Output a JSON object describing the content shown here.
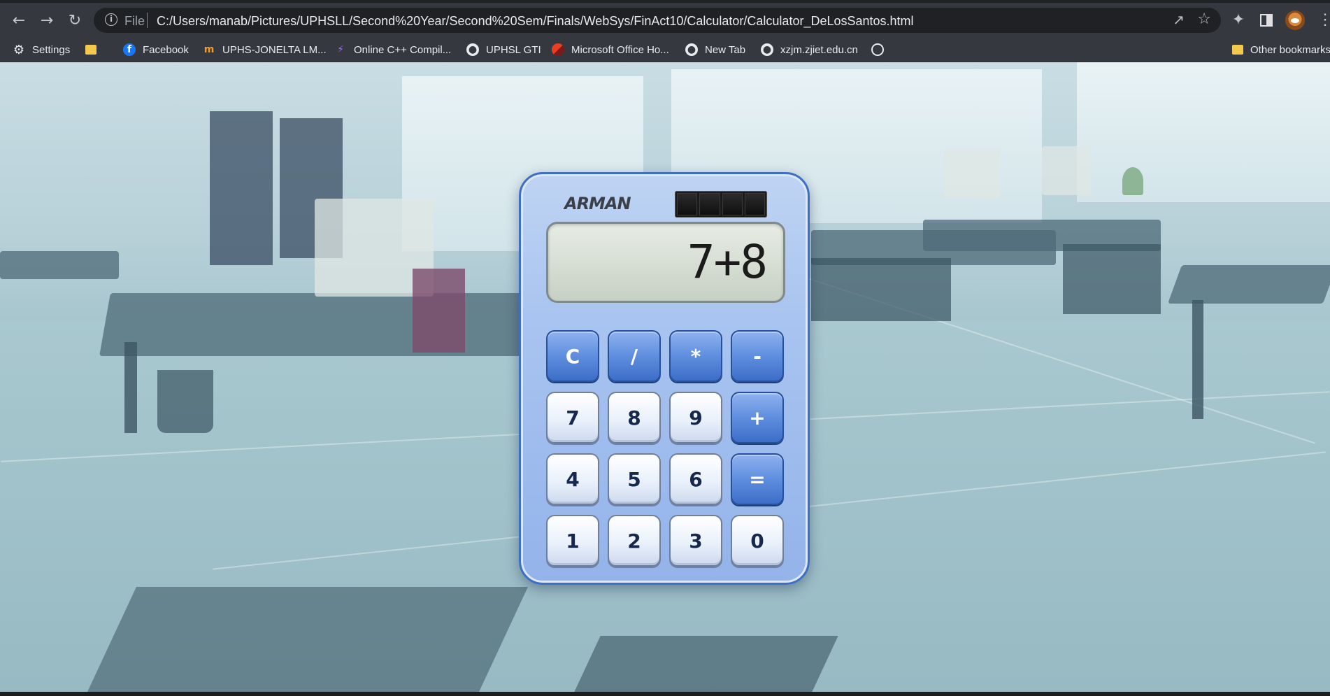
{
  "browser": {
    "omnibox": {
      "scheme_label": "File",
      "url": "C:/Users/manab/Pictures/UPHSLL/Second%20Year/Second%20Sem/Finals/WebSys/FinAct10/Calculator/Calculator_DeLosSantos.html"
    },
    "icons": {
      "back": "back-arrow-icon",
      "forward": "forward-arrow-icon",
      "reload": "reload-icon",
      "share": "share-icon",
      "bookmark": "star-icon",
      "extensions": "puzzle-icon",
      "side_panel": "side-panel-icon",
      "menu": "kebab-menu-icon"
    },
    "bookmarks": [
      {
        "label": "Settings",
        "icon": "gear-icon"
      },
      {
        "label": "",
        "icon": "folder-icon"
      },
      {
        "label": "Facebook",
        "icon": "facebook-icon"
      },
      {
        "label": "UPHS-JONELTA LM...",
        "icon": "moodle-icon"
      },
      {
        "label": "Online C++ Compil...",
        "icon": "bolt-icon"
      },
      {
        "label": "UPHSL GTI",
        "icon": "globe-icon"
      },
      {
        "label": "Microsoft Office Ho...",
        "icon": "office-icon"
      },
      {
        "label": "New Tab",
        "icon": "globe-icon"
      },
      {
        "label": "xzjm.zjiet.edu.cn",
        "icon": "globe-icon"
      },
      {
        "label": "",
        "icon": "app-icon"
      }
    ],
    "other_bookmarks": "Other bookmarks"
  },
  "calculator": {
    "brand": "ARMAN",
    "display": "7+8",
    "keys": [
      {
        "label": "C",
        "style": "dark"
      },
      {
        "label": "/",
        "style": "dark"
      },
      {
        "label": "*",
        "style": "dark"
      },
      {
        "label": "-",
        "style": "dark"
      },
      {
        "label": "7",
        "style": "light"
      },
      {
        "label": "8",
        "style": "light"
      },
      {
        "label": "9",
        "style": "light"
      },
      {
        "label": "+",
        "style": "dark"
      },
      {
        "label": "4",
        "style": "light"
      },
      {
        "label": "5",
        "style": "light"
      },
      {
        "label": "6",
        "style": "light"
      },
      {
        "label": "=",
        "style": "dark"
      },
      {
        "label": "1",
        "style": "light"
      },
      {
        "label": "2",
        "style": "light"
      },
      {
        "label": "3",
        "style": "light"
      },
      {
        "label": "0",
        "style": "light"
      }
    ],
    "colors": {
      "body": "#a9c4f0",
      "border": "#3e6fc4",
      "dark_key": "#5f8ede",
      "light_key": "#eaf1fb",
      "key_text": "#16294d",
      "screen": "#d9e0d6"
    }
  }
}
